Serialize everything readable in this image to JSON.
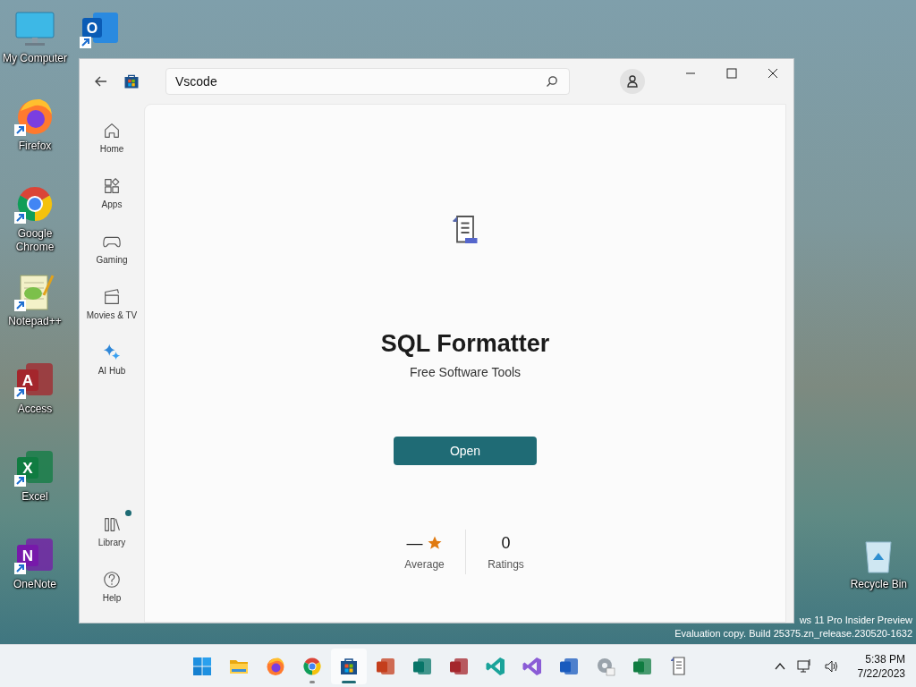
{
  "desktop": {
    "left_icons": [
      {
        "kind": "monitor",
        "label": "My Computer",
        "shortcut": false
      },
      {
        "kind": "firefox",
        "label": "Firefox",
        "shortcut": true
      },
      {
        "kind": "chrome",
        "label": "Google Chrome",
        "shortcut": true
      },
      {
        "kind": "notepad",
        "label": "Notepad++",
        "shortcut": true
      },
      {
        "kind": "access",
        "glyph": "A",
        "label": "Access",
        "shortcut": true
      },
      {
        "kind": "excel",
        "glyph": "X",
        "label": "Excel",
        "shortcut": true
      },
      {
        "kind": "onenote",
        "glyph": "N",
        "label": "OneNote",
        "shortcut": true
      }
    ],
    "second_icons": [
      {
        "kind": "outlook",
        "glyph": "O",
        "shortcut": true
      }
    ],
    "right_icons": [
      {
        "kind": "recycle",
        "label": "Recycle Bin",
        "shortcut": false
      }
    ],
    "watermark": [
      "ws 11 Pro Insider Preview",
      "Evaluation copy. Build 25375.zn_release.230520-1632"
    ]
  },
  "store": {
    "search": {
      "value": "Vscode"
    },
    "nav": [
      {
        "kind": "home",
        "label": "Home",
        "selected": false
      },
      {
        "kind": "apps",
        "label": "Apps",
        "selected": false
      },
      {
        "kind": "gaming",
        "label": "Gaming",
        "selected": false
      },
      {
        "kind": "movies",
        "label": "Movies & TV",
        "selected": false
      },
      {
        "kind": "ai",
        "label": "AI Hub",
        "selected": false
      }
    ],
    "nav_bottom": [
      {
        "kind": "library",
        "label": "Library",
        "badge": true
      },
      {
        "kind": "help",
        "label": "Help",
        "badge": false
      }
    ],
    "app": {
      "name": "SQL Formatter",
      "publisher": "Free Software Tools",
      "action": "Open",
      "rating": "—",
      "rating_label": "Average",
      "ratings_count": "0",
      "ratings_label": "Ratings"
    }
  },
  "taskbar": {
    "apps": [
      {
        "kind": "start",
        "selected": false,
        "running": false
      },
      {
        "kind": "folder",
        "selected": false,
        "running": false
      },
      {
        "kind": "firefox",
        "selected": false,
        "running": false
      },
      {
        "kind": "chrome",
        "selected": false,
        "running": true
      },
      {
        "kind": "store",
        "selected": true,
        "running": true
      },
      {
        "kind": "powerpoint",
        "selected": false,
        "running": false
      },
      {
        "kind": "publisher",
        "selected": false,
        "running": false
      },
      {
        "kind": "access",
        "selected": false,
        "running": false
      },
      {
        "kind": "vscode",
        "selected": false,
        "running": false
      },
      {
        "kind": "vstudio",
        "selected": false,
        "running": false
      },
      {
        "kind": "word",
        "selected": false,
        "running": false
      },
      {
        "kind": "settings",
        "selected": false,
        "running": false
      },
      {
        "kind": "excel",
        "selected": false,
        "running": false
      },
      {
        "kind": "doc",
        "selected": false,
        "running": false
      }
    ],
    "time": "5:38 PM",
    "date": "7/22/2023"
  }
}
